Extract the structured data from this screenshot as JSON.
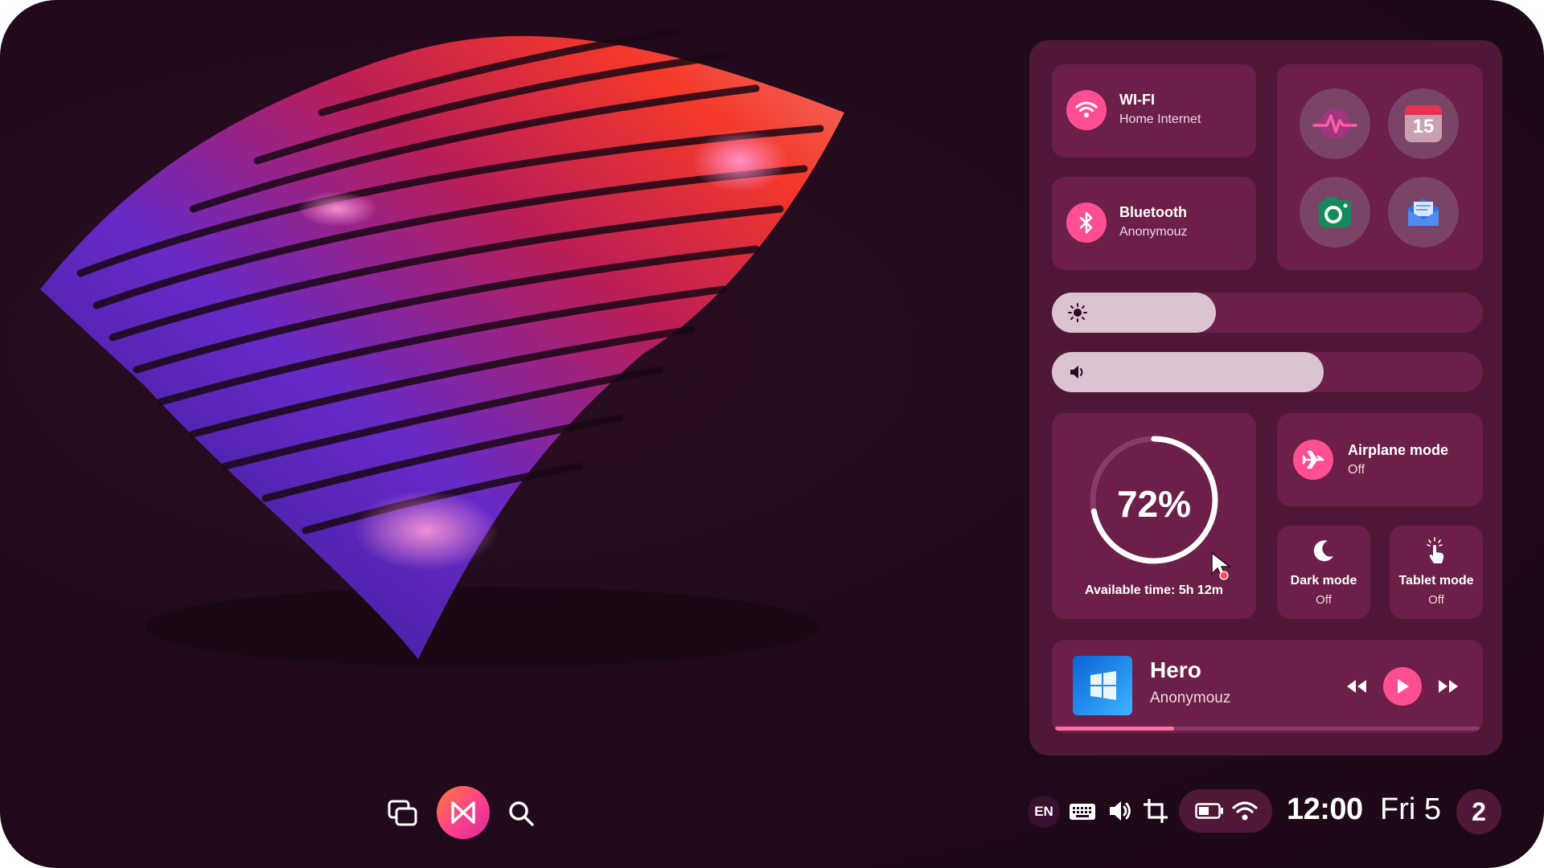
{
  "colors": {
    "background": "#220a1c",
    "panel": "#4f1838",
    "tile": "#6b1f49",
    "accent": "#ff4f93",
    "slider_fill": "#dcc3d2"
  },
  "quick_settings": {
    "wifi": {
      "title": "WI-FI",
      "subtitle": "Home Internet",
      "icon": "wifi-icon"
    },
    "bluetooth": {
      "title": "Bluetooth",
      "subtitle": "Anonymouz",
      "icon": "bluetooth-icon"
    },
    "apps": [
      {
        "name": "activity-app",
        "icon": "pulse-icon"
      },
      {
        "name": "calendar-app",
        "icon": "calendar-icon",
        "label": "15"
      },
      {
        "name": "camera-app",
        "icon": "camera-icon"
      },
      {
        "name": "mail-app",
        "icon": "mail-icon"
      }
    ],
    "brightness": {
      "icon": "sun-icon",
      "level": 0.38
    },
    "volume": {
      "icon": "speaker-icon",
      "level": 0.63
    },
    "battery": {
      "percent_label": "72%",
      "percent": 72,
      "available_time": "Available time: 5h 12m"
    },
    "airplane": {
      "title": "Airplane mode",
      "status": "Off",
      "icon": "airplane-icon"
    },
    "dark_mode": {
      "title": "Dark mode",
      "status": "Off",
      "icon": "moon-icon"
    },
    "tablet_mode": {
      "title": "Tablet mode",
      "status": "Off",
      "icon": "touch-icon"
    },
    "media": {
      "title": "Hero",
      "artist": "Anonymouz",
      "progress": 0.28
    }
  },
  "taskbar": {
    "language": "EN",
    "time": "12:00",
    "date": "Fri 5",
    "notification_count": "2"
  }
}
